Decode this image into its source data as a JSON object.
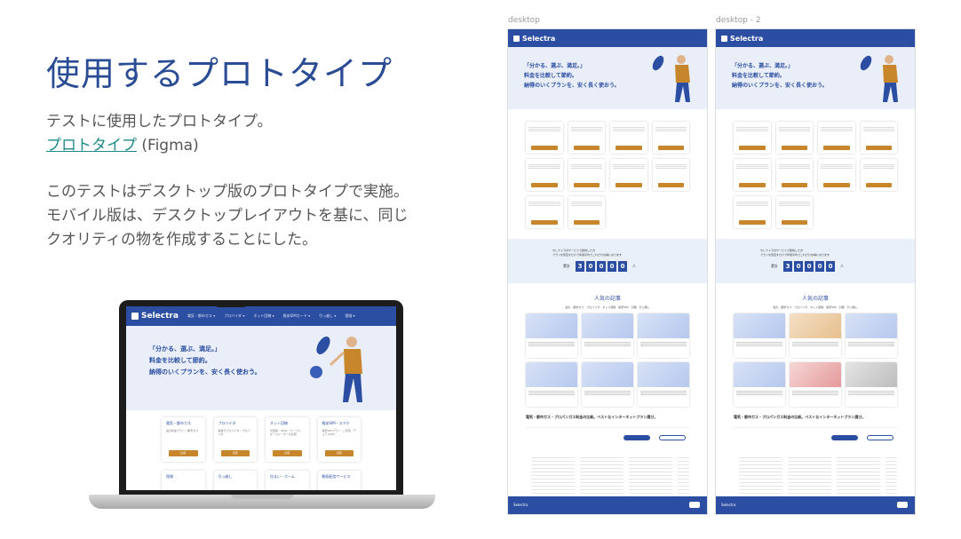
{
  "title": "使用するプロトタイプ",
  "intro": {
    "line1": "テストに使用したプロトタイプ。",
    "link_text": "プロトタイプ",
    "link_suffix": " (Figma)"
  },
  "description": {
    "line1": "このテストはデスクトップ版のプロトタイプで実施。",
    "line2": "モバイル版は、デスクトップレイアウトを基に、同じ",
    "line3": "クオリティの物を作成することにした。"
  },
  "prototype": {
    "logo": "Selectra",
    "nav": [
      "電気・都市ガス ▾",
      "プロバイダ ▾",
      "ネット回線 ▾",
      "格安SIMカード ▾",
      "引っ越し ▾",
      "保険 ▾"
    ],
    "hero_lines": [
      "「分かる、選ぶ、満足。」",
      "料金を比較して節約。",
      "納得のいくプランを、安く長く使おう。"
    ],
    "cards": [
      {
        "title": "電気・都市ガス",
        "text": "電気料金プラン・都市ガス"
      },
      {
        "title": "プロバイダ",
        "text": "提供元プロバイダ・プロバイダ"
      },
      {
        "title": "ネット回線",
        "text": "光回線・ADSL・ケーブル・ホームルーターの比較"
      },
      {
        "title": "格安SIM・スマホ",
        "text": "格安SIMプラン・ご自宅・デュアルSIM"
      }
    ],
    "card_button": "比較",
    "bottom_cards": [
      "保険",
      "引っ越し",
      "住まい・ホーム",
      "動画配信サービス"
    ]
  },
  "frames": [
    {
      "label": "desktop"
    },
    {
      "label": "desktop - 2"
    }
  ],
  "frame_content": {
    "logo": "Selectra",
    "hero_lines": [
      "「分かる、選ぶ、満足。」",
      "料金を比較して節約。",
      "納得のいくプランを、安く長く使おう。"
    ],
    "counter_text_1": "セレクトラのサービスで節約した方",
    "counter_text_2": "プランを見直すだけで年間平均でこれだけお得になります",
    "counter_label": "累計",
    "counter_digits": [
      "3",
      "0",
      "0",
      "0",
      "0"
    ],
    "counter_unit": "人",
    "popular_title": "人気の記事",
    "popular_tabs": "電気・都市ガス　プロバイダ　ネット回線　格安SIM　引越　引っ越し",
    "band_text": "電気・都市ガス・プロパンガス料金の比較。ベストなインターネットプラン選び。",
    "footer_left": "Selectra",
    "colors": {
      "brand_blue": "#2b4ea2",
      "accent_orange": "#c8862c"
    }
  }
}
